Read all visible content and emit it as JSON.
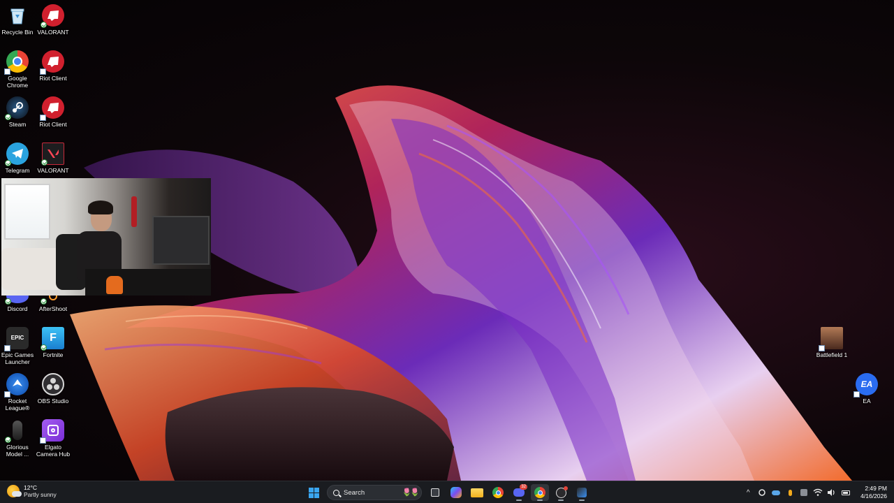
{
  "desktop": {
    "icons": [
      {
        "label": "Recycle Bin",
        "icon": "recycle-bin-icon",
        "color": "#4ea3d8"
      },
      {
        "label": "VALORANT",
        "icon": "valorant-riot-icon",
        "color": "#d1202e"
      },
      {
        "label": "Google\nChrome",
        "icon": "chrome-icon",
        "color": "#e8453c"
      },
      {
        "label": "Riot Client",
        "icon": "riot-client-icon",
        "color": "#d1202e"
      },
      {
        "label": "Steam",
        "icon": "steam-icon",
        "color": "#1b2838"
      },
      {
        "label": "Riot Client",
        "icon": "riot-client-icon",
        "color": "#d1202e"
      },
      {
        "label": "Telegram",
        "icon": "telegram-icon",
        "color": "#2aa3df"
      },
      {
        "label": "VALORANT",
        "icon": "valorant-icon",
        "color": "#1d1d1f"
      },
      {
        "label": "Discord",
        "icon": "discord-icon",
        "color": "#5865f2"
      },
      {
        "label": "AfterShoot",
        "icon": "aftershoot-icon",
        "color": "#ff9f2f"
      },
      {
        "label": "Epic Games\nLauncher",
        "icon": "epic-games-icon",
        "color": "#2a2a2a"
      },
      {
        "label": "Fortnite",
        "icon": "fortnite-icon",
        "color": "#2aa6e8"
      },
      {
        "label": "Rocket\nLeague®",
        "icon": "rocket-league-icon",
        "color": "#1c6fd8"
      },
      {
        "label": "OBS Studio",
        "icon": "obs-studio-icon",
        "color": "#302e31"
      },
      {
        "label": "Glorious\nModel ...",
        "icon": "glorious-mouse-icon",
        "color": "#2b2b2b"
      },
      {
        "label": "Elgato\nCamera Hub",
        "icon": "elgato-camera-hub-icon",
        "color": "#8a3fe0"
      },
      {
        "label": "Battlefield 1",
        "icon": "battlefield-icon",
        "color": "#8a5a3a"
      },
      {
        "label": "EA",
        "icon": "ea-icon",
        "color": "#2a6cf0"
      }
    ],
    "glyphs": {
      "epic": "EPIC",
      "fortnite": "F",
      "ea": "EA"
    }
  },
  "taskbar": {
    "weather": {
      "temp": "12°C",
      "desc": "Partly sunny"
    },
    "search_placeholder": "Search",
    "search_decoration": "🌷🌷",
    "apps": [
      {
        "name": "start",
        "icon": "windows-start-icon"
      },
      {
        "name": "task-view",
        "icon": "task-view-icon"
      },
      {
        "name": "copilot",
        "icon": "copilot-icon"
      },
      {
        "name": "file-explorer",
        "icon": "folder-icon"
      },
      {
        "name": "chrome",
        "icon": "chrome-icon"
      },
      {
        "name": "discord",
        "icon": "discord-icon",
        "badge": "32"
      },
      {
        "name": "chrome-2",
        "icon": "chrome-icon"
      },
      {
        "name": "obs",
        "icon": "obs-icon"
      },
      {
        "name": "photo-app",
        "icon": "photo-app-icon"
      }
    ],
    "tray": {
      "chevron": "^",
      "clock_time": "2:49 PM",
      "clock_date": "4/16/2026"
    }
  },
  "webcam": {
    "label": "webcam-overlay"
  }
}
